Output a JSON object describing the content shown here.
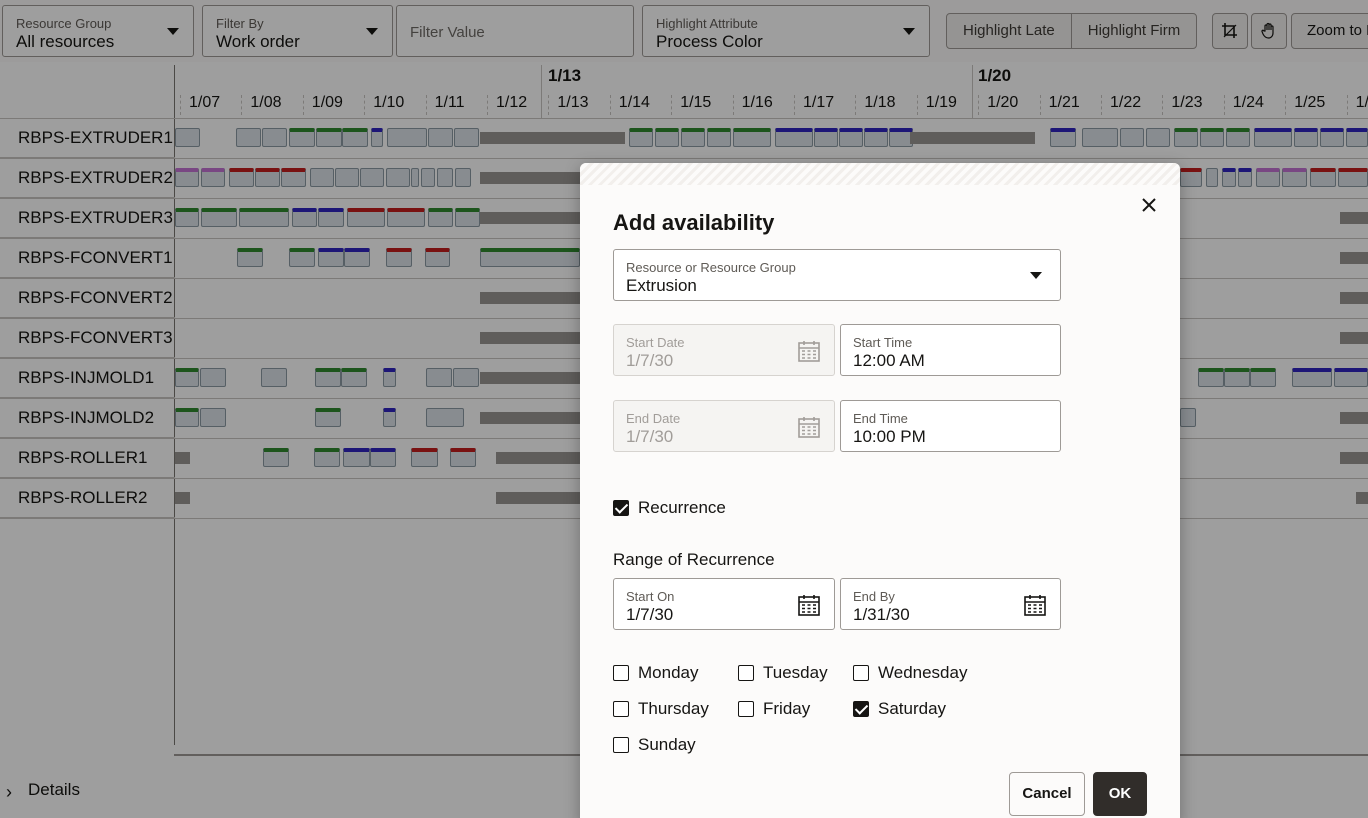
{
  "toolbar": {
    "resource_group": {
      "label": "Resource Group",
      "value": "All resources"
    },
    "filter_by": {
      "label": "Filter By",
      "value": "Work order"
    },
    "filter_value": {
      "placeholder": "Filter Value"
    },
    "highlight_attribute": {
      "label": "Highlight Attribute",
      "value": "Process Color"
    },
    "highlight_late": "Highlight Late",
    "highlight_firm": "Highlight Firm",
    "crop_icon": "crop-icon",
    "hand_icon": "hand-pan-icon",
    "zoom_label": "Zoom to F"
  },
  "gantt": {
    "week_labels": [
      "1/13",
      "1/20"
    ],
    "dates": [
      "1/07",
      "1/08",
      "1/09",
      "1/10",
      "1/11",
      "1/12",
      "1/13",
      "1/14",
      "1/15",
      "1/16",
      "1/17",
      "1/18",
      "1/19",
      "1/20",
      "1/21",
      "1/22",
      "1/23",
      "1/24",
      "1/25",
      "1/"
    ],
    "resources": [
      "RBPS-EXTRUDER1",
      "RBPS-EXTRUDER2",
      "RBPS-EXTRUDER3",
      "RBPS-FCONVERT1",
      "RBPS-FCONVERT2",
      "RBPS-FCONVERT3",
      "RBPS-INJMOLD1",
      "RBPS-INJMOLD2",
      "RBPS-ROLLER1",
      "RBPS-ROLLER2"
    ],
    "colors": {
      "green": "#2f8a2f",
      "red": "#c41e1e",
      "blue": "#2f24c0",
      "purple": "#c373d3",
      "summary": "#9a9794"
    }
  },
  "details": {
    "label": "Details"
  },
  "dialog": {
    "title": "Add availability",
    "resource": {
      "label": "Resource or Resource Group",
      "value": "Extrusion"
    },
    "start_date": {
      "label": "Start Date",
      "value": "1/7/30"
    },
    "start_time": {
      "label": "Start Time",
      "value": "12:00 AM"
    },
    "end_date": {
      "label": "End Date",
      "value": "1/7/30"
    },
    "end_time": {
      "label": "End Time",
      "value": "10:00 PM"
    },
    "recurrence": {
      "label": "Recurrence",
      "checked": true
    },
    "range_title": "Range of Recurrence",
    "start_on": {
      "label": "Start On",
      "value": "1/7/30"
    },
    "end_by": {
      "label": "End By",
      "value": "1/31/30"
    },
    "days": [
      {
        "label": "Monday",
        "checked": false
      },
      {
        "label": "Tuesday",
        "checked": false
      },
      {
        "label": "Wednesday",
        "checked": false
      },
      {
        "label": "Thursday",
        "checked": false
      },
      {
        "label": "Friday",
        "checked": false
      },
      {
        "label": "Saturday",
        "checked": true
      },
      {
        "label": "Sunday",
        "checked": false
      }
    ],
    "cancel": "Cancel",
    "ok": "OK"
  }
}
